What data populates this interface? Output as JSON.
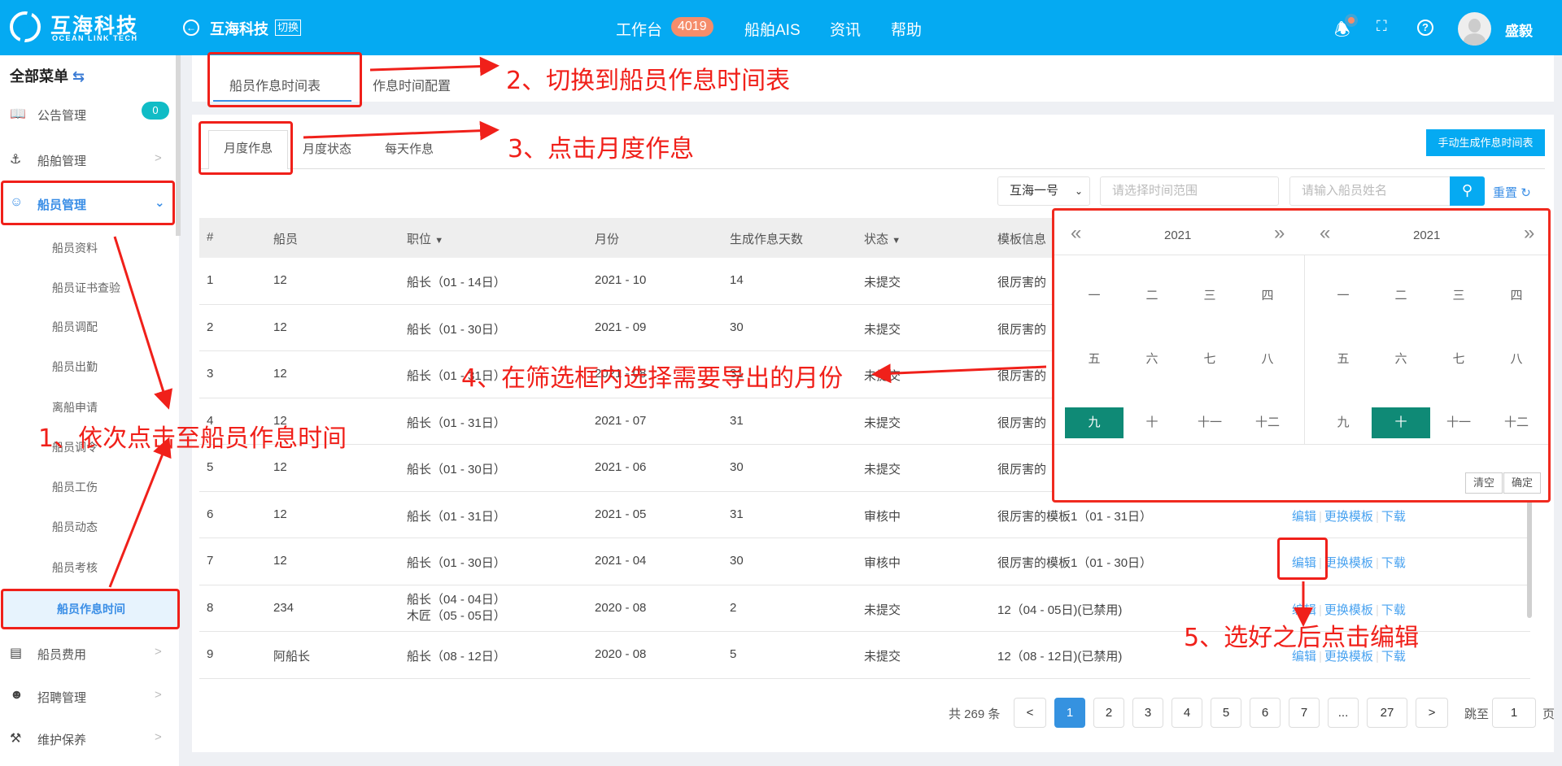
{
  "header": {
    "logo_cn": "互海科技",
    "logo_en": "OCEAN LINK TECH",
    "company": "互海科技",
    "switch_label": "切换",
    "nav": [
      {
        "label": "工作台",
        "badge": "4019"
      },
      {
        "label": "船舶AIS"
      },
      {
        "label": "资讯"
      },
      {
        "label": "帮助"
      }
    ],
    "user": "盛毅"
  },
  "sidebar": {
    "title": "全部菜单",
    "items": [
      {
        "label": "公告管理",
        "badge": "0"
      },
      {
        "label": "船舶管理"
      },
      {
        "label": "船员管理"
      },
      {
        "label": "船员费用"
      },
      {
        "label": "招聘管理"
      },
      {
        "label": "维护保养"
      }
    ],
    "sub_items": [
      "船员资料",
      "船员证书查验",
      "船员调配",
      "船员出勤",
      "离船申请",
      "船员调令",
      "船员工伤",
      "船员动态",
      "船员考核",
      "船员作息时间"
    ]
  },
  "tabs": [
    "船员作息时间表",
    "作息时间配置"
  ],
  "subtabs": [
    "月度作息",
    "月度状态",
    "每天作息"
  ],
  "generate_button": "手动生成作息时间表",
  "filters": {
    "vessel": "互海一号",
    "date_placeholder": "请选择时间范围",
    "name_placeholder": "请输入船员姓名",
    "reset": "重置"
  },
  "table": {
    "columns": [
      "#",
      "船员",
      "职位",
      "月份",
      "生成作息天数",
      "状态",
      "模板信息"
    ],
    "actions": [
      "编辑",
      "更换模板",
      "下载"
    ],
    "rows": [
      {
        "no": "1",
        "crew": "12",
        "position": [
          "船长（01 - 14日）"
        ],
        "month": "2021 - 10",
        "days": "14",
        "status": "未提交",
        "template": "很厉害的"
      },
      {
        "no": "2",
        "crew": "12",
        "position": [
          "船长（01 - 30日）"
        ],
        "month": "2021 - 09",
        "days": "30",
        "status": "未提交",
        "template": "很厉害的"
      },
      {
        "no": "3",
        "crew": "12",
        "position": [
          "船长（01 - 31日）"
        ],
        "month": "2021 - 08",
        "days": "31",
        "status": "未提交",
        "template": "很厉害的"
      },
      {
        "no": "4",
        "crew": "12",
        "position": [
          "船长（01 - 31日）"
        ],
        "month": "2021 - 07",
        "days": "31",
        "status": "未提交",
        "template": "很厉害的"
      },
      {
        "no": "5",
        "crew": "12",
        "position": [
          "船长（01 - 30日）"
        ],
        "month": "2021 - 06",
        "days": "30",
        "status": "未提交",
        "template": "很厉害的"
      },
      {
        "no": "6",
        "crew": "12",
        "position": [
          "船长（01 - 31日）"
        ],
        "month": "2021 - 05",
        "days": "31",
        "status": "审核中",
        "template": "很厉害的模板1（01 - 31日）"
      },
      {
        "no": "7",
        "crew": "12",
        "position": [
          "船长（01 - 30日）"
        ],
        "month": "2021 - 04",
        "days": "30",
        "status": "审核中",
        "template": "很厉害的模板1（01 - 30日）"
      },
      {
        "no": "8",
        "crew": "234",
        "position": [
          "船长（04 - 04日）",
          "木匠（05 - 05日）"
        ],
        "month": "2020 - 08",
        "days": "2",
        "status": "未提交",
        "template": "12（04 - 05日)(已禁用)"
      },
      {
        "no": "9",
        "crew": "阿船长",
        "position": [
          "船长（08 - 12日）"
        ],
        "month": "2020 - 08",
        "days": "5",
        "status": "未提交",
        "template": "12（08 - 12日)(已禁用)"
      }
    ]
  },
  "month_picker": {
    "left_year": "2021",
    "right_year": "2021",
    "months": [
      "一",
      "二",
      "三",
      "四",
      "五",
      "六",
      "七",
      "八",
      "九",
      "十",
      "十一",
      "十二"
    ],
    "left_selected": "九",
    "right_selected": "十",
    "clear": "清空",
    "confirm": "确定",
    "selected_color": "#0f8a76"
  },
  "pagination": {
    "total": "共 269 条",
    "prev": "<",
    "next": ">",
    "pages": [
      "1",
      "2",
      "3",
      "4",
      "5",
      "6",
      "7",
      "...",
      "27"
    ],
    "current": "1",
    "jump_label": "跳至",
    "jump_value": "1",
    "page_unit": "页"
  },
  "annotations": [
    "1、依次点击至船员作息时间",
    "2、切换到船员作息时间表",
    "3、点击月度作息",
    "4、在筛选框内选择需要导出的月份",
    "5、选好之后点击编辑"
  ],
  "colors": {
    "header": "#05aaf2",
    "annotation": "#f0201a",
    "link": "#4aa3f0"
  }
}
